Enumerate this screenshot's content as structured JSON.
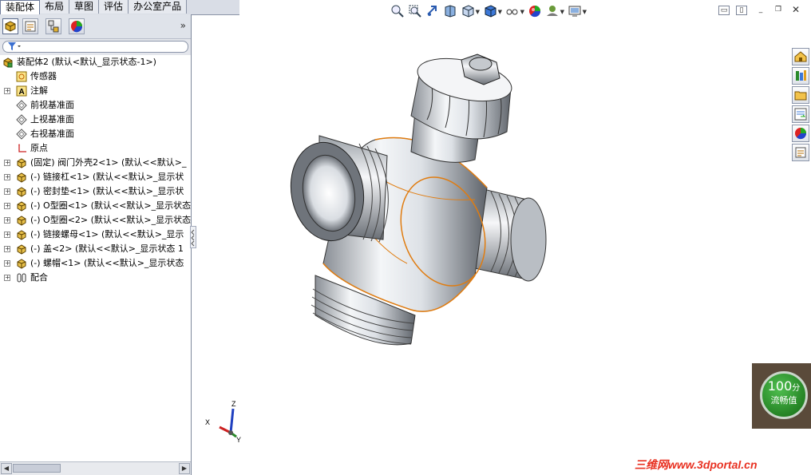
{
  "tabs": [
    "装配体",
    "布局",
    "草图",
    "评估",
    "办公室产品"
  ],
  "active_tab": 0,
  "panel": {
    "collapse_glyph": "»",
    "filter_icon": "funnel-icon",
    "tree": [
      {
        "label": "装配体2  (默认<默认_显示状态-1>)",
        "icon": "assembly-icon",
        "expand": false,
        "level": 0
      },
      {
        "label": "传感器",
        "icon": "sensor-icon",
        "expand": false,
        "level": 1
      },
      {
        "label": "注解",
        "icon": "annotation-icon",
        "expand": true,
        "level": 1
      },
      {
        "label": "前视基准面",
        "icon": "plane-icon",
        "expand": false,
        "level": 1
      },
      {
        "label": "上视基准面",
        "icon": "plane-icon",
        "expand": false,
        "level": 1
      },
      {
        "label": "右视基准面",
        "icon": "plane-icon",
        "expand": false,
        "level": 1
      },
      {
        "label": "原点",
        "icon": "origin-icon",
        "expand": false,
        "level": 1
      },
      {
        "label": "(固定) 阀门外壳2<1> (默认<<默认>_",
        "icon": "part-icon",
        "expand": true,
        "level": 1
      },
      {
        "label": "(-) 链接杠<1> (默认<<默认>_显示状",
        "icon": "part-icon",
        "expand": true,
        "level": 1
      },
      {
        "label": "(-) 密封垫<1> (默认<<默认>_显示状",
        "icon": "part-icon",
        "expand": true,
        "level": 1
      },
      {
        "label": "(-) O型圈<1> (默认<<默认>_显示状态",
        "icon": "part-icon",
        "expand": true,
        "level": 1
      },
      {
        "label": "(-) O型圈<2> (默认<<默认>_显示状态",
        "icon": "part-icon",
        "expand": true,
        "level": 1
      },
      {
        "label": "(-) 链接螺母<1> (默认<<默认>_显示",
        "icon": "part-icon",
        "expand": true,
        "level": 1
      },
      {
        "label": "(-) 盖<2> (默认<<默认>_显示状态 1",
        "icon": "part-icon",
        "expand": true,
        "level": 1
      },
      {
        "label": "(-) 螺帽<1> (默认<<默认>_显示状态",
        "icon": "part-icon",
        "expand": true,
        "level": 1
      },
      {
        "label": "配合",
        "icon": "mates-icon",
        "expand": true,
        "level": 1
      }
    ]
  },
  "triad": {
    "x": "X",
    "y": "Y",
    "z": "Z"
  },
  "badge": {
    "score": "100",
    "unit": "分",
    "caption": "流畅值"
  },
  "watermark": "三维网www.3dportal.cn",
  "colors": {
    "accent": "#e07c10",
    "panel_bg": "#e4e6ec",
    "badge_green": "#1f8a1f"
  }
}
